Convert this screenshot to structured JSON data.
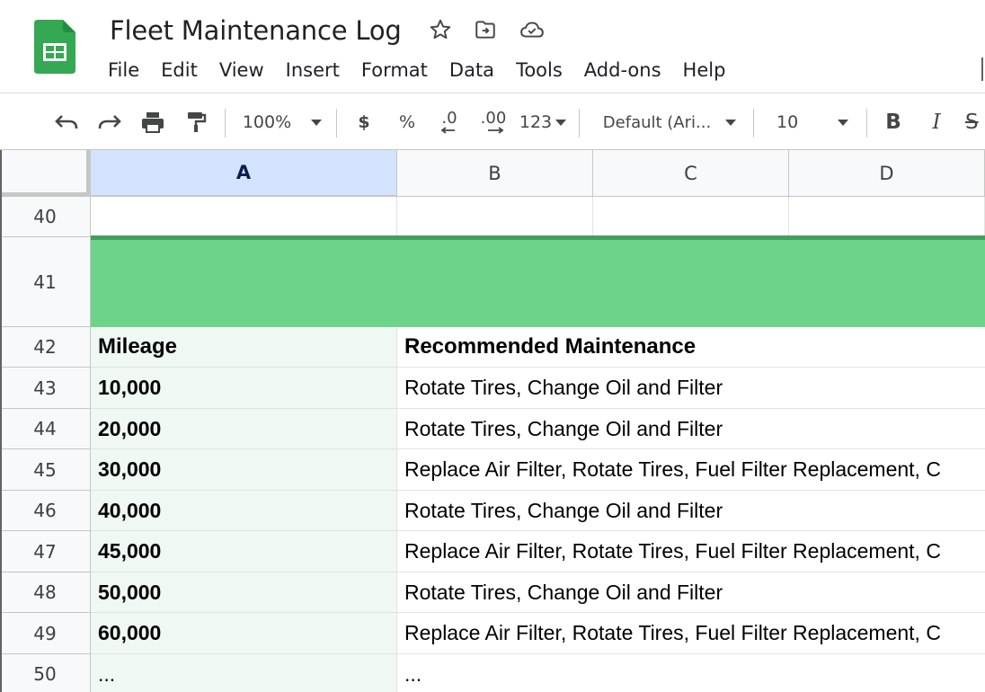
{
  "app": {
    "title": "Fleet Maintenance Log",
    "icons": [
      "sheets-logo-icon",
      "star-icon",
      "move-to-folder-icon",
      "cloud-saved-icon"
    ]
  },
  "menu": [
    "File",
    "Edit",
    "View",
    "Insert",
    "Format",
    "Data",
    "Tools",
    "Add-ons",
    "Help"
  ],
  "toolbar": {
    "zoom": "100%",
    "currency": "$",
    "percent": "%",
    "decrease_decimal": ".0",
    "increase_decimal": ".00",
    "number_format": "123",
    "font": "Default (Ari...",
    "font_size": "10",
    "bold": "B",
    "italic": "I",
    "strike": "S"
  },
  "columns": [
    "A",
    "B",
    "C",
    "D"
  ],
  "selected_column": "A",
  "rows": [
    {
      "num": "40",
      "a": "",
      "b": ""
    },
    {
      "num": "41",
      "a": "",
      "b": ""
    },
    {
      "num": "42",
      "a": "Mileage",
      "b": "Recommended Maintenance"
    },
    {
      "num": "43",
      "a": "10,000",
      "b": "Rotate Tires, Change Oil and Filter"
    },
    {
      "num": "44",
      "a": "20,000",
      "b": "Rotate Tires, Change Oil and Filter"
    },
    {
      "num": "45",
      "a": "30,000",
      "b": "Replace Air Filter, Rotate Tires, Fuel Filter Replacement, C"
    },
    {
      "num": "46",
      "a": "40,000",
      "b": "Rotate Tires, Change Oil and Filter"
    },
    {
      "num": "47",
      "a": "45,000",
      "b": "Replace Air Filter, Rotate Tires, Fuel Filter Replacement, C"
    },
    {
      "num": "48",
      "a": "50,000",
      "b": "Rotate Tires, Change Oil and Filter"
    },
    {
      "num": "49",
      "a": "60,000",
      "b": "Replace Air Filter, Rotate Tires, Fuel Filter Replacement, C"
    },
    {
      "num": "50",
      "a": "...",
      "b": "..."
    }
  ],
  "colors": {
    "banner": "#6dd38a",
    "banner_border": "#43a05c",
    "column_a_fill": "#eff8f2",
    "selected_header": "#d3e3fd"
  }
}
